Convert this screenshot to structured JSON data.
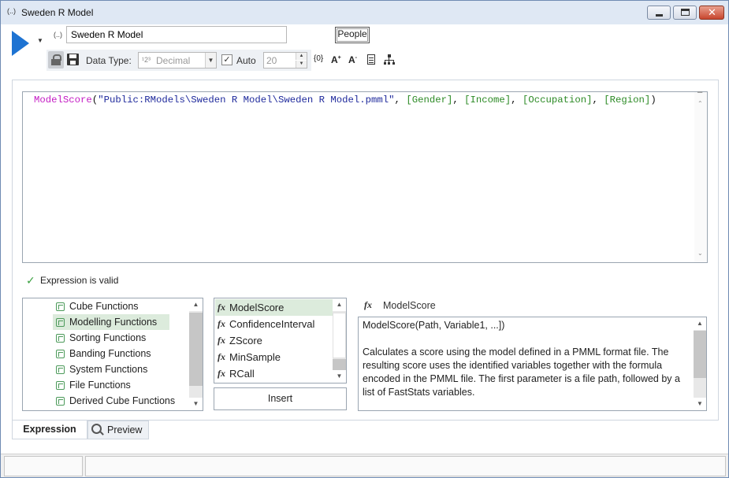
{
  "window": {
    "icon": "(..)",
    "title": "Sweden R Model"
  },
  "header": {
    "expr_icon": "(..)",
    "name_value": "Sweden R Model",
    "people_label": "People"
  },
  "toolbar": {
    "data_type_label": "Data Type:",
    "data_type_icon": "¹2³",
    "data_type_value": "Decimal",
    "auto_label": "Auto",
    "auto_checked": true,
    "number_value": "20"
  },
  "editor": {
    "function_name": "ModelScore",
    "open_paren": "(",
    "path_string": "\"Public:RModels\\Sweden R Model\\Sweden R Model.pmml\"",
    "separator": ", ",
    "fields": [
      "[Gender]",
      "[Income]",
      "[Occupation]",
      "[Region]"
    ],
    "close_paren": ")"
  },
  "validation": {
    "message": "Expression is valid",
    "color": "#3aa040"
  },
  "categories": {
    "items": [
      {
        "label": "Cube Functions"
      },
      {
        "label": "Modelling Functions"
      },
      {
        "label": "Sorting Functions"
      },
      {
        "label": "Banding Functions"
      },
      {
        "label": "System Functions"
      },
      {
        "label": "File Functions"
      },
      {
        "label": "Derived Cube Functions"
      }
    ],
    "selected_index": 1
  },
  "functions": {
    "items": [
      {
        "label": "ModelScore"
      },
      {
        "label": "ConfidenceInterval"
      },
      {
        "label": "ZScore"
      },
      {
        "label": "MinSample"
      },
      {
        "label": "RCall"
      }
    ],
    "selected_index": 0,
    "insert_label": "Insert"
  },
  "help": {
    "icon": "fx",
    "title": "ModelScore",
    "signature": "ModelScore(Path, Variable1, ...])",
    "description": "Calculates a score using the model defined in a PMML format file. The resulting score uses the identified variables together with the formula encoded in the PMML file. The first parameter is a file path, followed by a list of FastStats variables."
  },
  "tabs": [
    {
      "label": "Expression",
      "active": true
    },
    {
      "label": "Preview",
      "active": false
    }
  ],
  "colors": {
    "accent": "#1e73d2",
    "function": "#c41cc4",
    "string": "#1f2a9c",
    "field": "#2c8a25",
    "selection": "#dcebdc"
  }
}
